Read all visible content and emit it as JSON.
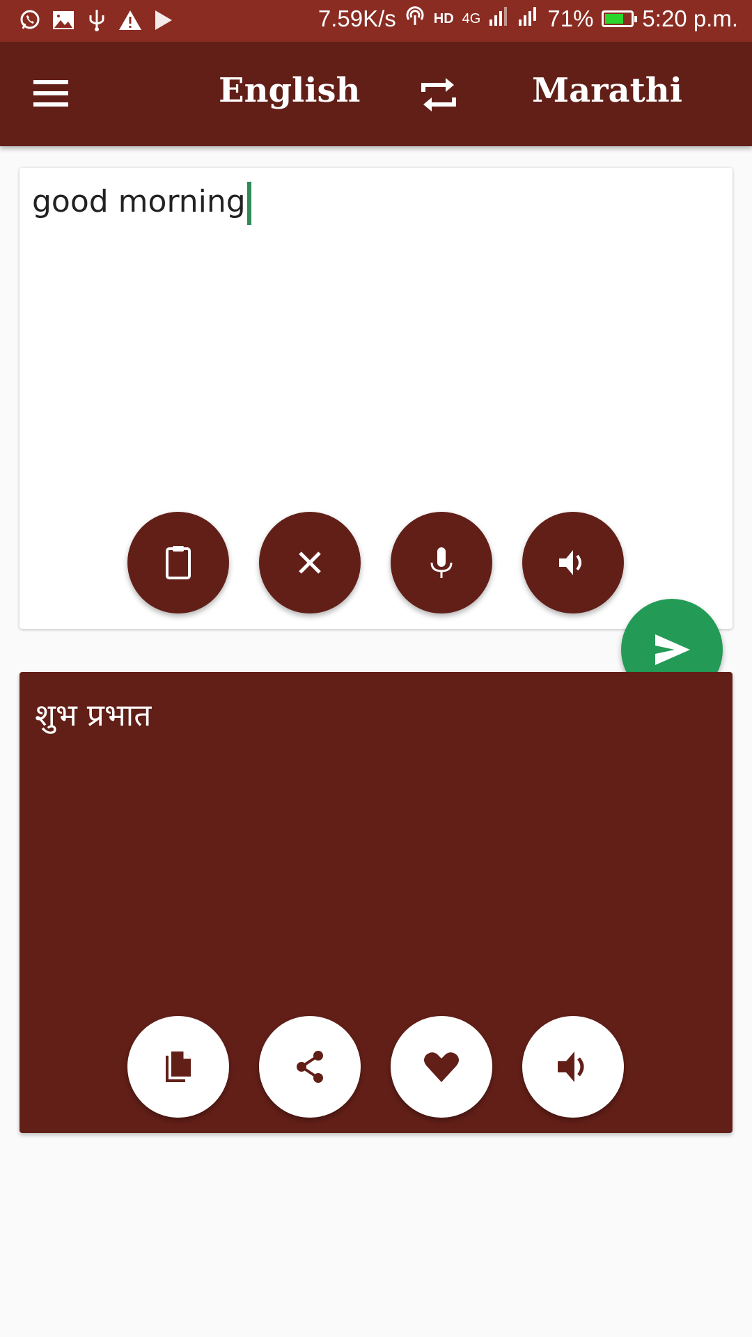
{
  "status_bar": {
    "notification_icons": [
      "whatsapp-icon",
      "image-icon",
      "usb-icon",
      "warning-icon",
      "play-store-icon"
    ],
    "network_speed": "7.59K/s",
    "network_type": "4G",
    "battery_percent": "71%",
    "battery_level": 0.71,
    "battery_color": "#2bd52b",
    "time": "5:20 p.m."
  },
  "app_bar": {
    "source_language": "English",
    "target_language": "Marathi",
    "menu_icon": "hamburger-menu-icon",
    "swap_icon": "swap-languages-icon"
  },
  "input_card": {
    "text": "good morning",
    "actions": [
      {
        "name": "paste",
        "icon": "clipboard-icon"
      },
      {
        "name": "clear",
        "icon": "close-icon"
      },
      {
        "name": "voice-input",
        "icon": "microphone-icon"
      },
      {
        "name": "speak",
        "icon": "speaker-icon"
      }
    ]
  },
  "translate_button": {
    "icon": "send-icon"
  },
  "output_card": {
    "text": "शुभ प्रभात",
    "actions": [
      {
        "name": "copy",
        "icon": "copy-icon"
      },
      {
        "name": "share",
        "icon": "share-icon"
      },
      {
        "name": "favorite",
        "icon": "heart-icon"
      },
      {
        "name": "speak",
        "icon": "speaker-icon"
      }
    ]
  },
  "colors": {
    "status_bar": "#8a2c22",
    "primary": "#621f18",
    "accent_green": "#239b56",
    "caret": "#2e8b57",
    "background": "#fafafa"
  }
}
